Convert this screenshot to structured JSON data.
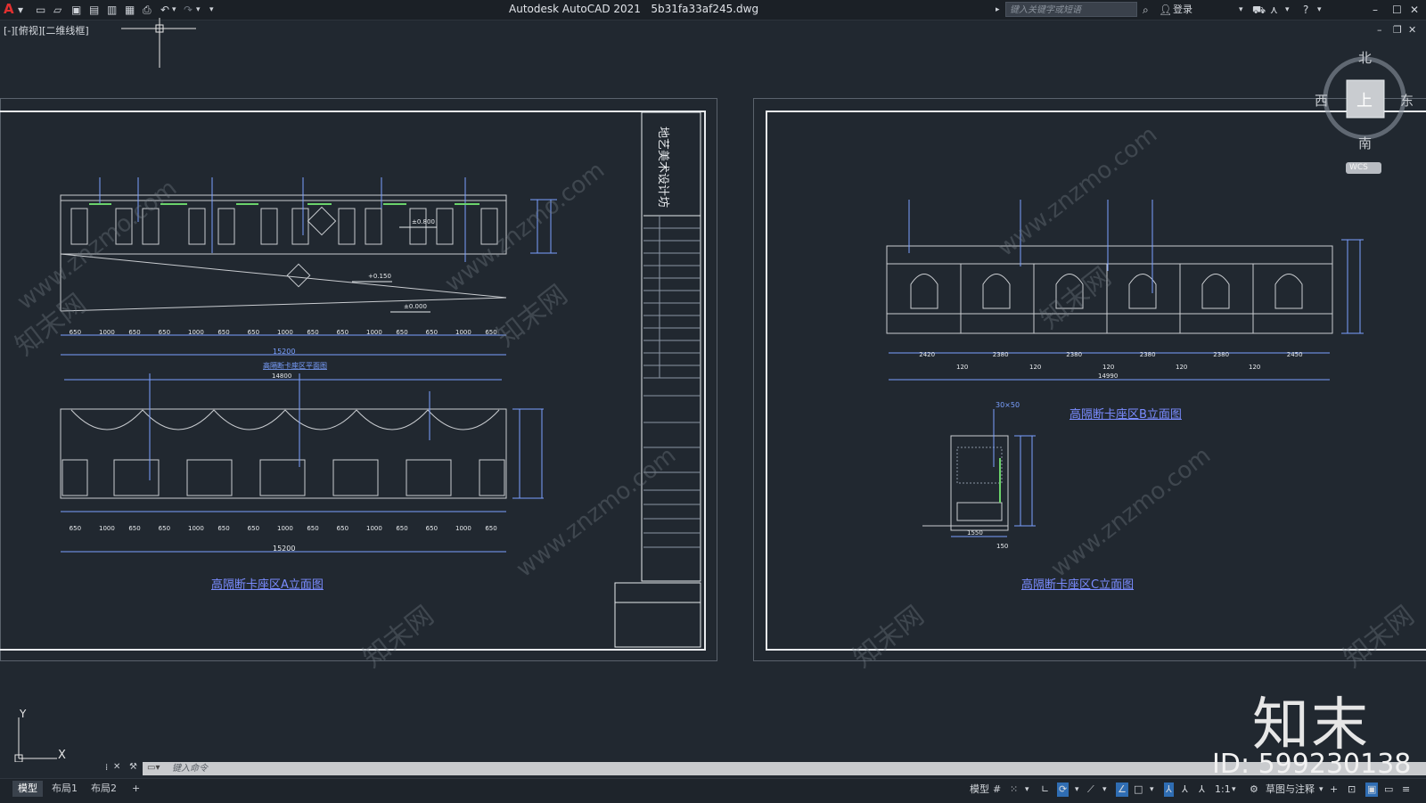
{
  "app": {
    "title": "Autodesk AutoCAD 2021",
    "filename": "5b31fa33af245.dwg",
    "search_placeholder": "键入关键字或短语",
    "login_label": "登录",
    "view_label": "[-][俯视][二维线框]"
  },
  "viewcube": {
    "north": "北",
    "south": "南",
    "east": "东",
    "west": "西",
    "top": "上",
    "wcs": "WCS"
  },
  "ucs": {
    "x": "X",
    "y": "Y"
  },
  "drawing": {
    "plan_label": "高隔断卡座区平面图",
    "elev_a_title": "高隔断卡座区A立面图",
    "elev_b_title": "高隔断卡座区B立面图",
    "elev_c_title": "高隔断卡座区C立面图",
    "titleblock_text": "地艺美术设计坊",
    "level_0800": "±0.800",
    "level_0150": "+0.150",
    "level_0000": "±0.000",
    "dim_total_a": "15200",
    "dim_total_a2": "14800",
    "dim_total_b": "14990",
    "dim_c_left": "30×50",
    "dim_c_bottom": "1550",
    "dim_c_150": "150",
    "dims_a": [
      "650",
      "1000",
      "650",
      "650",
      "1000",
      "650",
      "650",
      "1000",
      "650",
      "650",
      "1000",
      "650",
      "650",
      "1000",
      "650"
    ],
    "dims_b": [
      "2420",
      "2380",
      "2380",
      "2380",
      "2380",
      "2450"
    ],
    "dims_b_small": [
      "120",
      "120",
      "120",
      "120",
      "120"
    ]
  },
  "watermark": {
    "site": "www.znzmo.com",
    "brand": "知末网",
    "logo": "知末",
    "id": "ID: 599230138"
  },
  "command": {
    "placeholder": "键入命令"
  },
  "tabs": [
    "模型",
    "布局1",
    "布局2",
    "+"
  ],
  "status": {
    "model": "模型",
    "scale": "1:1",
    "workspace": "草图与注释"
  }
}
